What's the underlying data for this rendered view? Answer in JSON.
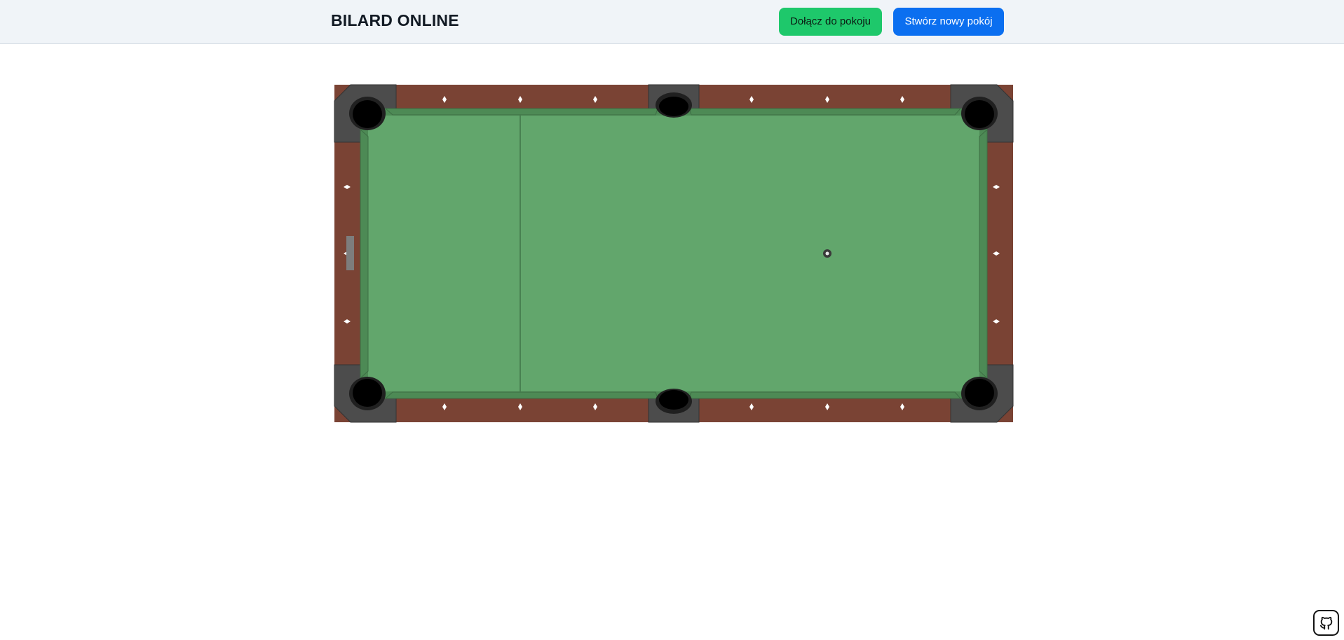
{
  "header": {
    "title": "BILARD ONLINE",
    "join_label": "Dołącz do pokoju",
    "create_label": "Stwórz nowy pokój"
  },
  "table": {
    "colors": {
      "felt": "#62a66c",
      "cushion": "#4d8a55",
      "rail": "#7a4334",
      "pocket_frame": "#4c4c4c",
      "pocket": "#000000",
      "diamond": "#ffffff"
    },
    "cue_ball_count": 1
  },
  "footer": {
    "github_icon": "github-icon"
  }
}
